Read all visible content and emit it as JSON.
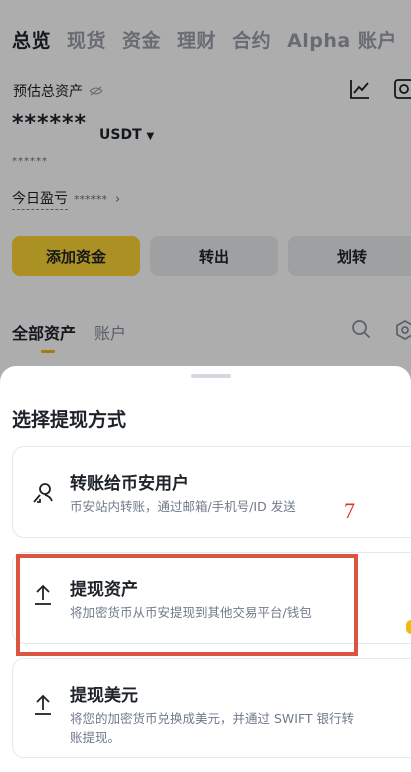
{
  "top_tabs": [
    "总览",
    "现货",
    "资金",
    "理财",
    "合约",
    "Alpha 账户"
  ],
  "overview": {
    "estimated_label": "预估总资产",
    "balance_masked": "******",
    "currency": "USDT",
    "sub_balance_masked": "******",
    "pnl_label": "今日盈亏",
    "pnl_masked": "******"
  },
  "actions": {
    "add_funds": "添加资金",
    "withdraw": "转出",
    "transfer": "划转"
  },
  "asset_tabs": [
    "全部资产",
    "账户"
  ],
  "sheet": {
    "title": "选择提现方式",
    "options": [
      {
        "title": "转账给币安用户",
        "description": "币安站内转账，通过邮箱/手机号/ID 发送"
      },
      {
        "title": "提现资产",
        "description": "将加密货币从币安提现到其他交易平台/钱包"
      },
      {
        "title": "提现美元",
        "description": "将您的加密货币兑换成美元，并通过 SWIFT 银行转账提现。"
      }
    ]
  },
  "annotation": {
    "step_number": "7"
  },
  "colors": {
    "brand_yellow": "#fcd535",
    "annotation_red": "#d9553f"
  }
}
